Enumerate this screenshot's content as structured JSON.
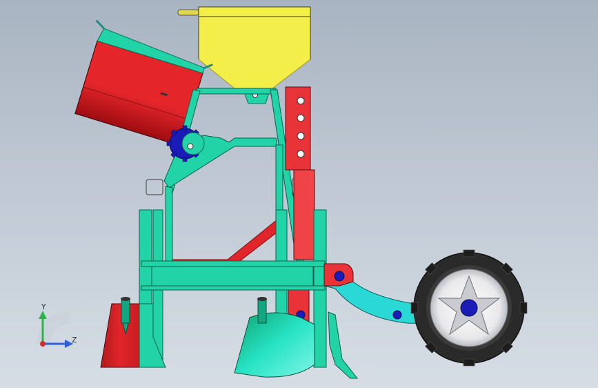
{
  "viewport": {
    "background_top": "#a9b4c2",
    "background_bottom": "#d6dde5"
  },
  "triad": {
    "y_label": "Y",
    "z_label": "Z",
    "y_color": "#2fb34a",
    "z_color": "#2f5fd6",
    "origin_color": "#d62b2b"
  },
  "colors": {
    "frame": "#22d3a8",
    "frame_dark": "#13a781",
    "hopper": "#f3ee4a",
    "hopper_dark": "#c6c021",
    "seed_box": "#e4262b",
    "seed_box_dark": "#a91014",
    "post": "#e83338",
    "opener_cyan": "#1fe7c9",
    "wheel_arm": "#2ad9d6",
    "pin_blue": "#1b1bb8",
    "tire": "#2a2a2a",
    "rim": "#eeeeee"
  },
  "icons": [
    "sprocket-icon",
    "coordinate-triad-icon"
  ]
}
